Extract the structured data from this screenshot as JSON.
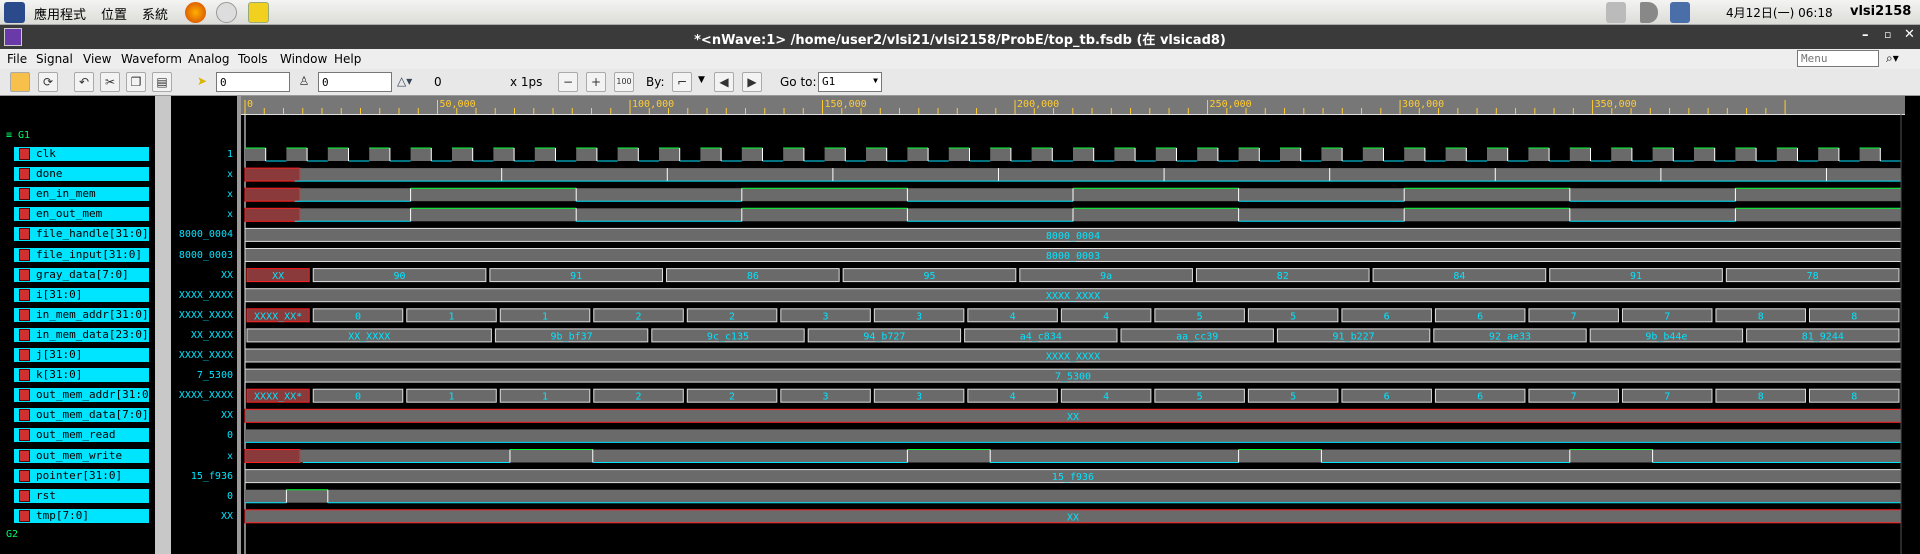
{
  "desktop": {
    "apps": "應用程式",
    "places": "位置",
    "system": "系統",
    "datetime": "4月12日(一) 06:18",
    "user": "vlsi2158"
  },
  "window": {
    "title": "*<nWave:1> /home/user2/vlsi21/vlsi2158/ProbE/top_tb.fsdb (在 vlsicad8)"
  },
  "menu": {
    "items": [
      "File",
      "Signal",
      "View",
      "Waveform",
      "Analog",
      "Tools",
      "Window",
      "Help"
    ],
    "search_placeholder": "Menu"
  },
  "toolbar": {
    "cursor_time": "0",
    "marker_time": "0",
    "delta": "0",
    "unit": "x 1ps",
    "by_label": "By:",
    "goto_label": "Go to:",
    "goto_value": "G1"
  },
  "ruler": {
    "labels": [
      "0",
      "50,000",
      "100,000",
      "150,000",
      "200,000",
      "250,000",
      "300,000",
      "350,000"
    ]
  },
  "groups": {
    "g1": "G1",
    "g2": "G2"
  },
  "signals": [
    {
      "name": "clk",
      "value": "1",
      "type": "clock",
      "icon": "wave-icon"
    },
    {
      "name": "done",
      "value": "x",
      "type": "done",
      "icon": "bit-icon"
    },
    {
      "name": "en_in_mem",
      "value": "x",
      "type": "slow",
      "icon": "bit-icon"
    },
    {
      "name": "en_out_mem",
      "value": "x",
      "type": "slow",
      "icon": "bit-icon"
    },
    {
      "name": "file_handle[31:0]",
      "value": "8000_0004",
      "type": "const",
      "icon": "bus-icon",
      "label": "8000_0004"
    },
    {
      "name": "file_input[31:0]",
      "value": "8000_0003",
      "type": "const",
      "icon": "bus-icon",
      "label": "8000_0003"
    },
    {
      "name": "gray_data[7:0]",
      "value": "XX",
      "type": "bus",
      "icon": "bus-icon",
      "segments": [
        [
          "XX",
          "x"
        ],
        [
          "90",
          ""
        ],
        [
          "91",
          ""
        ],
        [
          "86",
          ""
        ],
        [
          "95",
          ""
        ],
        [
          "9a",
          ""
        ],
        [
          "82",
          ""
        ],
        [
          "84",
          ""
        ],
        [
          "91",
          ""
        ],
        [
          "78",
          ""
        ]
      ]
    },
    {
      "name": "i[31:0]",
      "value": "XXXX_XXXX",
      "type": "const",
      "icon": "bus-icon",
      "label": "XXXX_XXXX"
    },
    {
      "name": "in_mem_addr[31:0]",
      "value": "XXXX_XXXX",
      "type": "bus",
      "icon": "bit-icon",
      "segments": [
        [
          "XXXX_XX*",
          "x"
        ],
        [
          "0",
          ""
        ],
        [
          "1",
          ""
        ],
        [
          "1",
          ""
        ],
        [
          "2",
          ""
        ],
        [
          "2",
          ""
        ],
        [
          "3",
          ""
        ],
        [
          "3",
          ""
        ],
        [
          "4",
          ""
        ],
        [
          "4",
          ""
        ],
        [
          "5",
          ""
        ],
        [
          "5",
          ""
        ],
        [
          "6",
          ""
        ],
        [
          "6",
          ""
        ],
        [
          "7",
          ""
        ],
        [
          "7",
          ""
        ],
        [
          "8",
          ""
        ],
        [
          "8",
          ""
        ]
      ]
    },
    {
      "name": "in_mem_data[23:0]",
      "value": "XX_XXXX",
      "type": "bus",
      "icon": "bit-icon",
      "segments": [
        [
          "XX_XXXX",
          ""
        ],
        [
          "9b_bf37",
          ""
        ],
        [
          "9c_c135",
          ""
        ],
        [
          "94_b727",
          ""
        ],
        [
          "a4_c834",
          ""
        ],
        [
          "aa_cc39",
          ""
        ],
        [
          "91_b227",
          ""
        ],
        [
          "92_ae33",
          ""
        ],
        [
          "9b_b44e",
          ""
        ],
        [
          "81_9244",
          ""
        ]
      ]
    },
    {
      "name": "j[31:0]",
      "value": "XXXX_XXXX",
      "type": "const",
      "icon": "bus-icon",
      "label": "XXXX_XXXX"
    },
    {
      "name": "k[31:0]",
      "value": "7_5300",
      "type": "const",
      "icon": "bus-icon",
      "label": "7_5300"
    },
    {
      "name": "out_mem_addr[31:0]",
      "value": "XXXX_XXXX",
      "type": "bus",
      "icon": "bus-icon",
      "segments": [
        [
          "XXXX_XX*",
          "x"
        ],
        [
          "0",
          ""
        ],
        [
          "1",
          ""
        ],
        [
          "1",
          ""
        ],
        [
          "2",
          ""
        ],
        [
          "2",
          ""
        ],
        [
          "3",
          ""
        ],
        [
          "3",
          ""
        ],
        [
          "4",
          ""
        ],
        [
          "4",
          ""
        ],
        [
          "5",
          ""
        ],
        [
          "5",
          ""
        ],
        [
          "6",
          ""
        ],
        [
          "6",
          ""
        ],
        [
          "7",
          ""
        ],
        [
          "7",
          ""
        ],
        [
          "8",
          ""
        ],
        [
          "8",
          ""
        ]
      ]
    },
    {
      "name": "out_mem_data[7:0]",
      "value": "XX",
      "type": "xbus",
      "icon": "bus-icon",
      "label": "XX"
    },
    {
      "name": "out_mem_read",
      "value": "0",
      "type": "low",
      "icon": "bit-icon"
    },
    {
      "name": "out_mem_write",
      "value": "x",
      "type": "slow2",
      "icon": "bit-icon"
    },
    {
      "name": "pointer[31:0]",
      "value": "15_f936",
      "type": "const",
      "icon": "bus-icon",
      "label": "15_f936"
    },
    {
      "name": "rst",
      "value": "0",
      "type": "rst",
      "icon": "bus-icon"
    },
    {
      "name": "tmp[7:0]",
      "value": "XX",
      "type": "xbus",
      "icon": "bus-icon",
      "label": "XX"
    }
  ],
  "colors": {
    "trace_high": "#00ff33",
    "trace_low": "#00e5ff",
    "bus_fill": "#6a6a6a",
    "x_fill": "#ff2020",
    "label": "#00e5ff"
  }
}
